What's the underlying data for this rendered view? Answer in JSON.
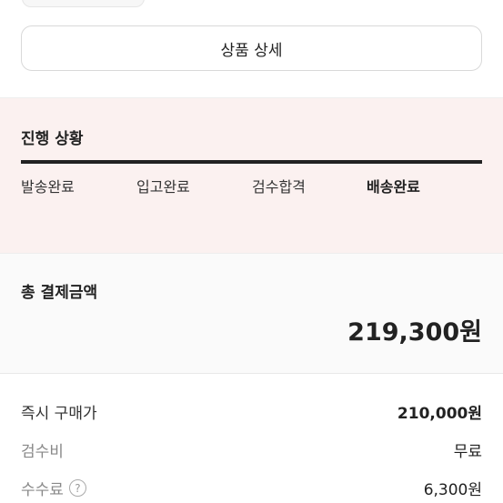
{
  "detail_button": {
    "label": "상품 상세"
  },
  "progress": {
    "title": "진행 상황",
    "steps": [
      {
        "label": "발송완료"
      },
      {
        "label": "입고완료"
      },
      {
        "label": "검수합격"
      },
      {
        "label": "배송완료"
      }
    ]
  },
  "total": {
    "label": "총 결제금액",
    "amount": "219,300원"
  },
  "breakdown": {
    "rows": [
      {
        "label": "즉시 구매가",
        "value": "210,000원"
      },
      {
        "label": "검수비",
        "value": "무료"
      },
      {
        "label": "수수료",
        "value": "6,300원",
        "help_icon": "question-icon"
      }
    ]
  }
}
